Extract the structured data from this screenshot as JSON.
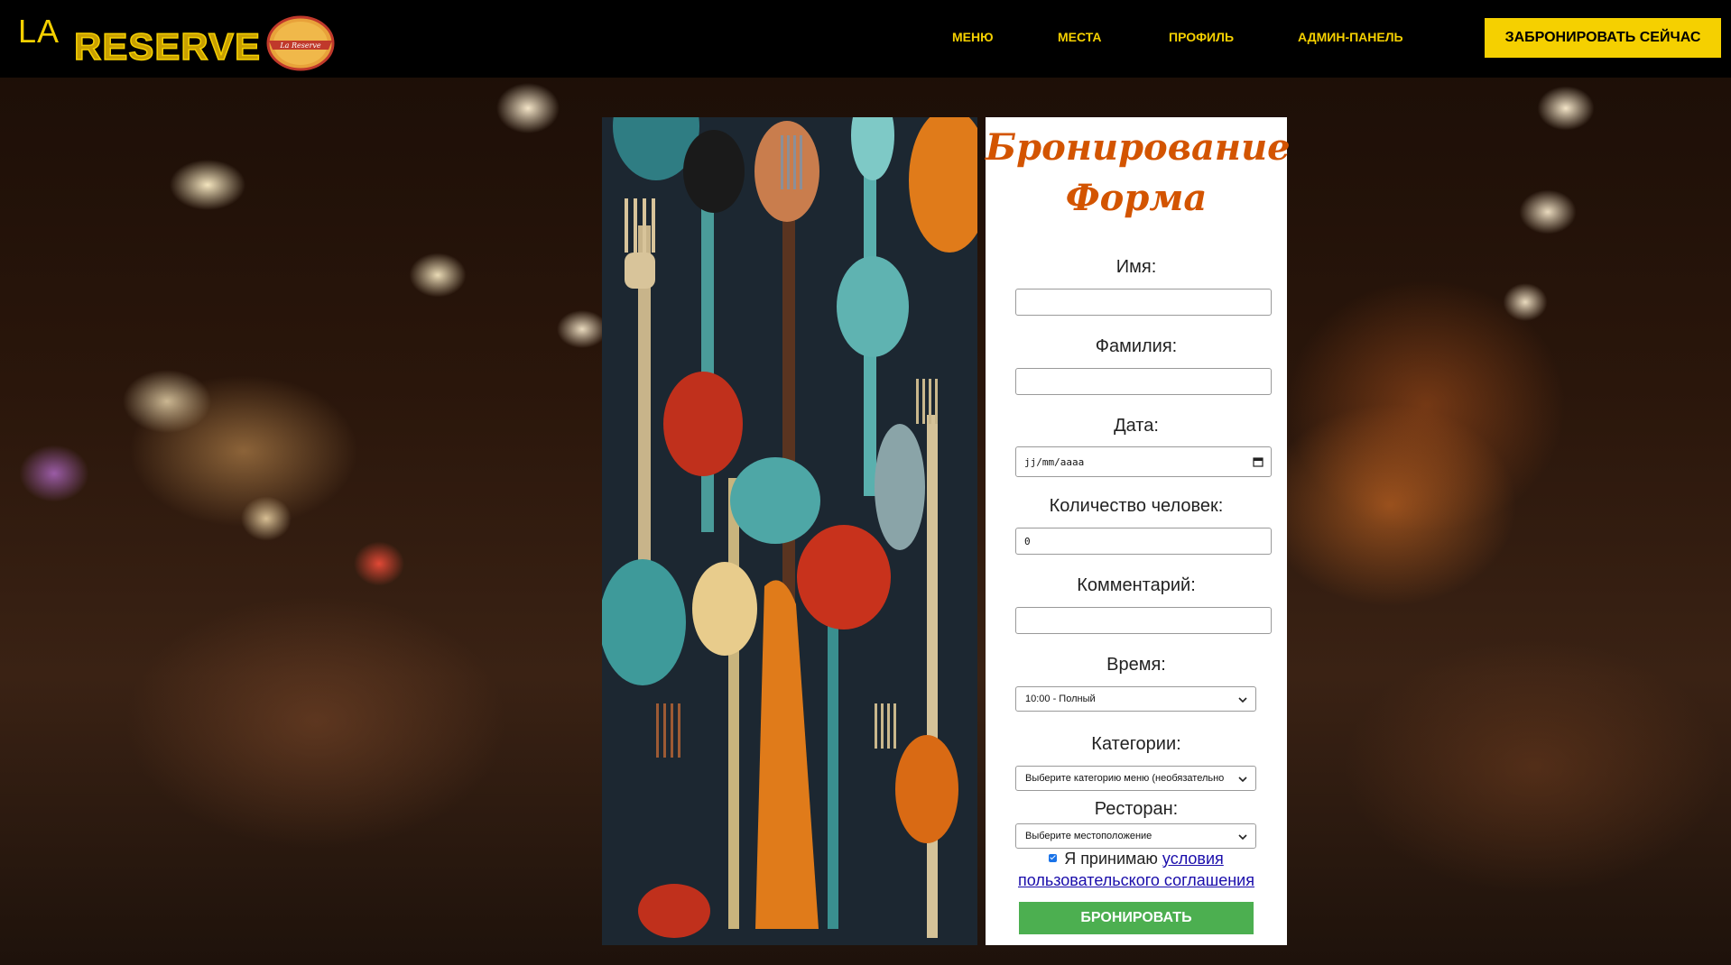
{
  "brand": {
    "la": "LA",
    "reserve": "RESERVE",
    "badge_text": "La Reserve"
  },
  "nav": {
    "items": [
      {
        "label": "МЕНЮ"
      },
      {
        "label": "МЕСТА"
      },
      {
        "label": "ПРОФИЛЬ"
      },
      {
        "label": "АДМИН-ПАНЕЛЬ"
      }
    ],
    "cta_label": "ЗАБРОНИРОВАТЬ СЕЙЧАС"
  },
  "form": {
    "title_line1": "Бронирование",
    "title_line2": "Форма",
    "first_name": {
      "label": "Имя:",
      "value": ""
    },
    "last_name": {
      "label": "Фамилия:",
      "value": ""
    },
    "date": {
      "label": "Дата:",
      "placeholder": "jj/mm/aaaa"
    },
    "people": {
      "label": "Количество человек:",
      "value": "0"
    },
    "comment": {
      "label": "Комментарий:",
      "value": ""
    },
    "time": {
      "label": "Время:",
      "selected": "10:00 - Полный"
    },
    "category": {
      "label": "Категории:",
      "selected": "Выберите категорию меню (необязательно"
    },
    "restaurant": {
      "label": "Ресторан:",
      "selected": "Выберите местоположение"
    },
    "agreement": {
      "checked": true,
      "text": "Я принимаю",
      "link_part1": "условия",
      "link_part2": "пользовательского соглашения"
    },
    "submit_label": "БРОНИРОВАТЬ"
  },
  "colors": {
    "accent_yellow": "#f5d000",
    "title_orange": "#d35400",
    "submit_green": "#4caf50",
    "header_bg": "#000000"
  }
}
